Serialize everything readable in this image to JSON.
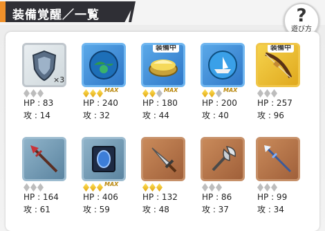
{
  "header": {
    "title": "装備覚醒／一覧",
    "help_symbol": "?",
    "help_label": "遊び方"
  },
  "labels": {
    "equipped": "装備中",
    "max": "MAX",
    "hp_prefix": "HP : ",
    "atk_prefix": "攻 : "
  },
  "colors": {
    "title_bar": "#2f2f35",
    "accent": "#f0902a",
    "gem_on": "#f5c518",
    "gem_off": "#bdbdbd"
  },
  "items": [
    {
      "icon": "shield-icon",
      "frame": "gray",
      "equipped": false,
      "count": "3",
      "gems": 0,
      "max": false,
      "hp": "83",
      "atk": "14"
    },
    {
      "icon": "world-orb-icon",
      "frame": "blue",
      "equipped": false,
      "count": "",
      "gems": 3,
      "max": true,
      "hp": "240",
      "atk": "32"
    },
    {
      "icon": "golden-disc-icon",
      "frame": "blue",
      "equipped": true,
      "count": "",
      "gems": 2,
      "max": true,
      "hp": "180",
      "atk": "44"
    },
    {
      "icon": "ship-orb-icon",
      "frame": "blue",
      "equipped": false,
      "count": "",
      "gems": 2,
      "max": true,
      "hp": "200",
      "atk": "40"
    },
    {
      "icon": "bow-icon",
      "frame": "gold",
      "equipped": true,
      "count": "",
      "gems": 0,
      "max": false,
      "hp": "257",
      "atk": "96"
    },
    {
      "icon": "spear-icon",
      "frame": "steel",
      "equipped": false,
      "count": "",
      "gems": 0,
      "max": false,
      "hp": "164",
      "atk": "61"
    },
    {
      "icon": "blue-shield-icon",
      "frame": "steel",
      "equipped": false,
      "count": "",
      "gems": 3,
      "max": true,
      "hp": "406",
      "atk": "59"
    },
    {
      "icon": "broadsword-icon",
      "frame": "bronze",
      "equipped": false,
      "count": "",
      "gems": 3,
      "max": false,
      "hp": "132",
      "atk": "48"
    },
    {
      "icon": "battle-axe-icon",
      "frame": "bronze",
      "equipped": false,
      "count": "",
      "gems": 0,
      "max": false,
      "hp": "86",
      "atk": "37"
    },
    {
      "icon": "ice-spear-icon",
      "frame": "bronze",
      "equipped": false,
      "count": "",
      "gems": 0,
      "max": false,
      "hp": "99",
      "atk": "34"
    }
  ]
}
